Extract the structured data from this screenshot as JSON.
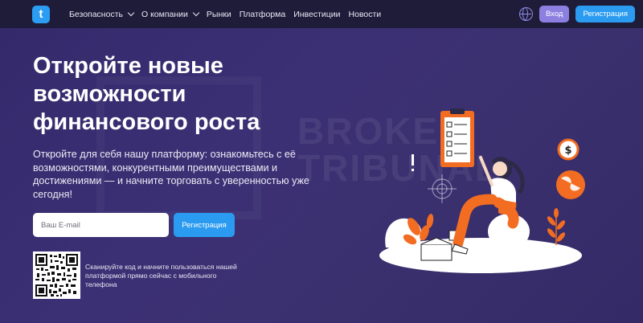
{
  "nav": {
    "logo_letter": "t",
    "items": [
      {
        "label": "Безопасность",
        "dropdown": true
      },
      {
        "label": "О компании",
        "dropdown": true
      },
      {
        "label": "Рынки",
        "dropdown": false
      },
      {
        "label": "Платформа",
        "dropdown": false
      },
      {
        "label": "Инвестиции",
        "dropdown": false
      },
      {
        "label": "Новости",
        "dropdown": false
      }
    ],
    "login_label": "Вход",
    "register_label": "Регистрация"
  },
  "hero": {
    "title": "Откройте новые возможности финансового роста",
    "subtitle": "Откройте для себя нашу платформу: ознакомьтесь с её возможностями, конкурентными преимуществами и достижениями — и начните торговать с уверенностью уже сегодня!",
    "email_placeholder": "Ваш E-mail",
    "register_label": "Регистрация"
  },
  "qr": {
    "text": "Сканируйте код и начните пользоваться нашей платформой прямо сейчас с мобильного телефона"
  },
  "watermark": {
    "line1": "BROKER",
    "line2": "TRIBUNAL"
  },
  "colors": {
    "background": "#3a2f6e",
    "nav_background": "#1f1c3a",
    "accent_blue": "#2a9bf0",
    "login_purple": "#8b7fe0",
    "illustration_orange": "#f26d21"
  },
  "icons": [
    "globe-icon",
    "chevron-down-icon",
    "dollar-icon",
    "target-icon",
    "checklist-icon"
  ]
}
